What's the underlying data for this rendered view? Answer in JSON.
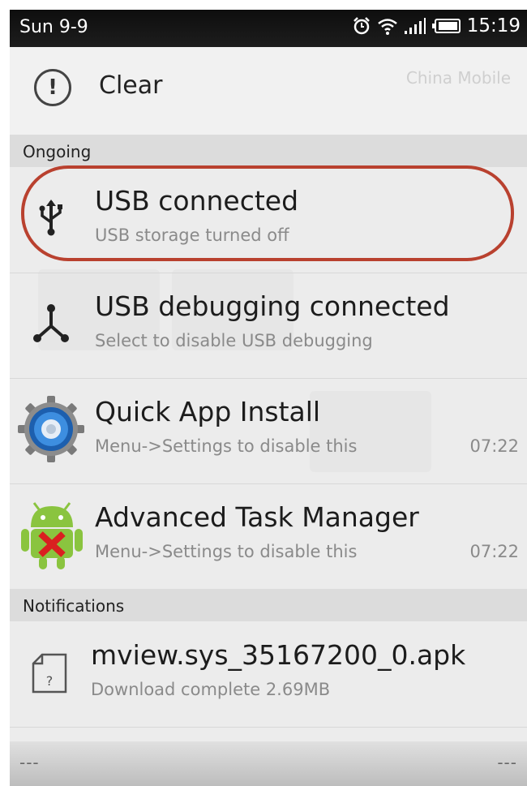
{
  "status_bar": {
    "date": "Sun 9-9",
    "time": "15:19"
  },
  "header": {
    "clear_label": "Clear",
    "carrier": "China Mobile"
  },
  "sections": {
    "ongoing": "Ongoing",
    "notifications": "Notifications"
  },
  "ongoing": [
    {
      "title": "USB connected",
      "subtitle": "USB storage turned off",
      "time": "",
      "icon": "usb-icon"
    },
    {
      "title": "USB debugging connected",
      "subtitle": "Select to disable USB debugging",
      "time": "",
      "icon": "usb-debug-icon"
    },
    {
      "title": "Quick App Install",
      "subtitle": "Menu->Settings to disable this",
      "time": "07:22",
      "icon": "gear-icon"
    },
    {
      "title": "Advanced Task Manager",
      "subtitle": "Menu->Settings to disable this",
      "time": "07:22",
      "icon": "android-icon"
    }
  ],
  "notifications": [
    {
      "title": "mview.sys_35167200_0.apk",
      "subtitle": "Download complete  2.69MB",
      "icon": "file-icon"
    }
  ],
  "bottom_bar": {
    "left": "---",
    "right": "---"
  },
  "colors": {
    "highlight": "#b9412f",
    "statusbar": "#161616"
  }
}
